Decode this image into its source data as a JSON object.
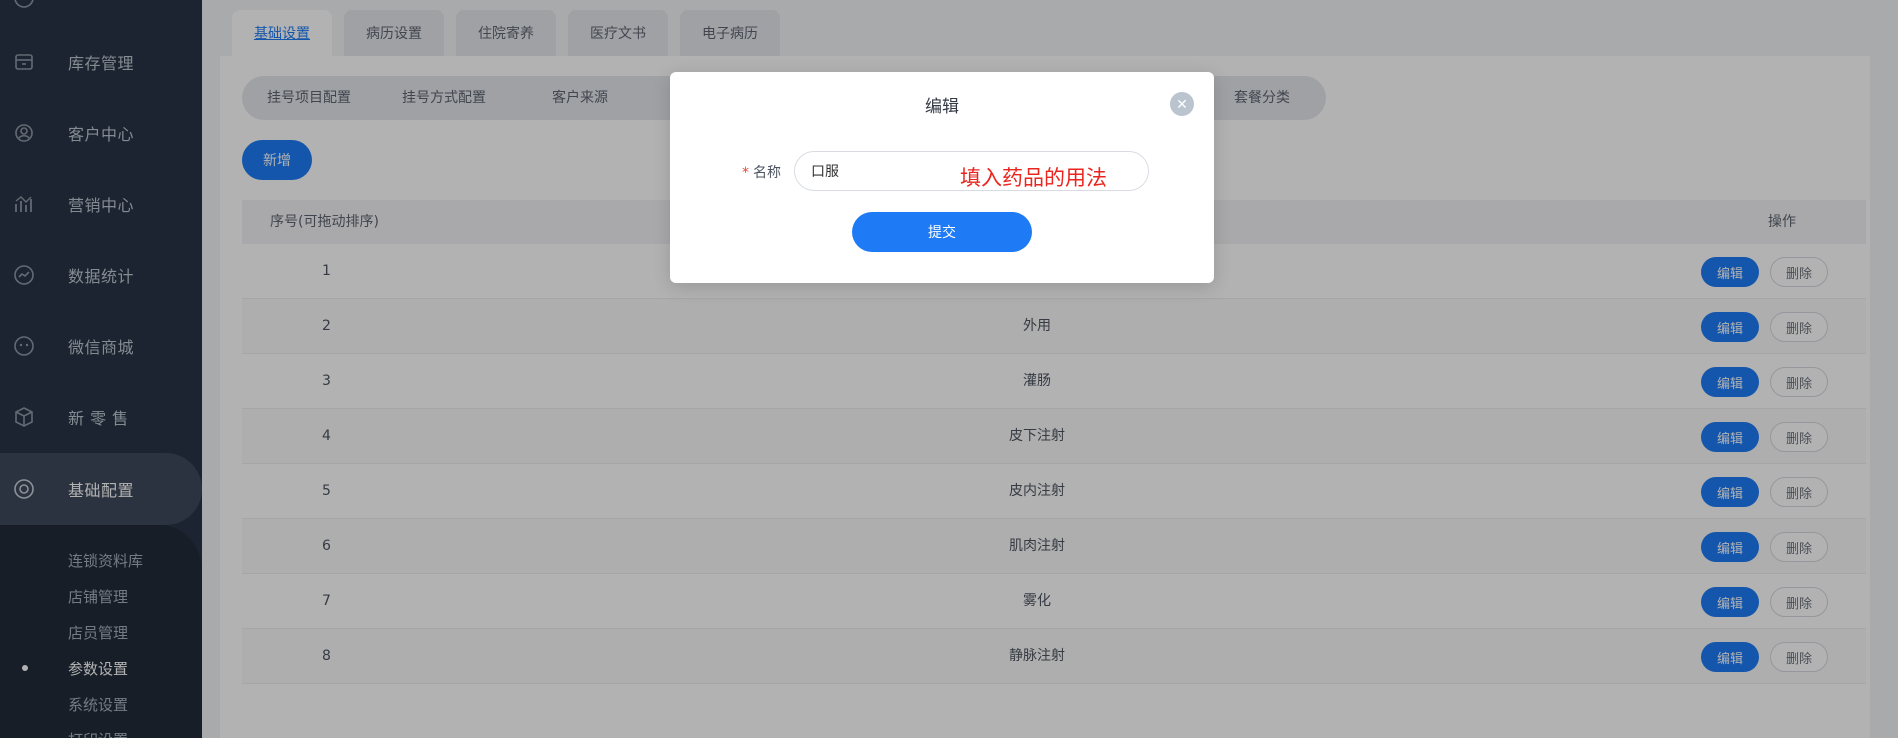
{
  "sidebar": {
    "items": [
      {
        "label": "库存管理",
        "icon": "inventory-icon"
      },
      {
        "label": "客户中心",
        "icon": "customer-icon"
      },
      {
        "label": "营销中心",
        "icon": "marketing-icon"
      },
      {
        "label": "数据统计",
        "icon": "statistics-icon"
      },
      {
        "label": "微信商城",
        "icon": "wechat-mall-icon"
      },
      {
        "label": "新 零 售",
        "icon": "retail-box-icon"
      },
      {
        "label": "基础配置",
        "icon": "settings-icon",
        "active": true
      }
    ],
    "sub_items": [
      {
        "label": "连锁资料库"
      },
      {
        "label": "店铺管理"
      },
      {
        "label": "店员管理"
      },
      {
        "label": "参数设置",
        "active": true
      },
      {
        "label": "系统设置"
      },
      {
        "label": "打印设置"
      }
    ]
  },
  "tabs": [
    {
      "label": "基础设置",
      "active": true
    },
    {
      "label": "病历设置"
    },
    {
      "label": "住院寄养"
    },
    {
      "label": "医疗文书"
    },
    {
      "label": "电子病历"
    }
  ],
  "subtabs": [
    {
      "label": "挂号项目配置"
    },
    {
      "label": "挂号方式配置"
    },
    {
      "label": "客户来源"
    },
    {
      "label": "套餐分类"
    }
  ],
  "toolbar": {
    "add_label": "新增"
  },
  "table": {
    "headers": {
      "index": "序号(可拖动排序)",
      "actions": "操作"
    },
    "edit_label": "编辑",
    "delete_label": "删除",
    "rows": [
      {
        "index": "1",
        "name": ""
      },
      {
        "index": "2",
        "name": "外用"
      },
      {
        "index": "3",
        "name": "灌肠"
      },
      {
        "index": "4",
        "name": "皮下注射"
      },
      {
        "index": "5",
        "name": "皮内注射"
      },
      {
        "index": "6",
        "name": "肌肉注射"
      },
      {
        "index": "7",
        "name": "雾化"
      },
      {
        "index": "8",
        "name": "静脉注射"
      }
    ]
  },
  "modal": {
    "title": "编辑",
    "field_required_mark": "*",
    "field_label": "名称",
    "field_value": "口服",
    "annotation": "填入药品的用法",
    "submit_label": "提交"
  },
  "colors": {
    "primary": "#1e7bf5",
    "sidebar_bg": "#283445",
    "annotation": "#e8261f"
  }
}
